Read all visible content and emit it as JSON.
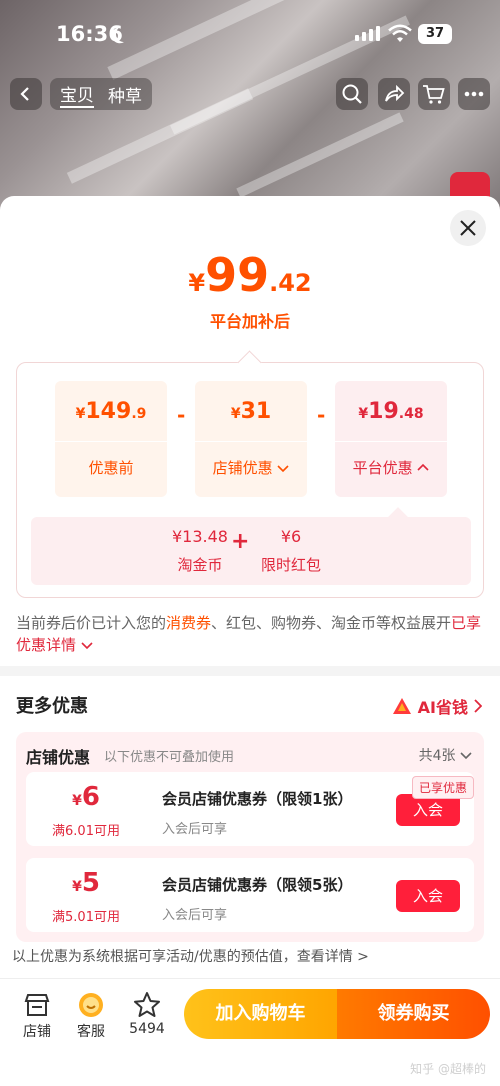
{
  "status": {
    "time": "16:36",
    "battery": "37"
  },
  "nav": {
    "tabs": [
      "宝贝",
      "种草"
    ]
  },
  "price": {
    "currency": "¥",
    "integer": "99",
    "decimal": ".42",
    "caption": "平台加补后"
  },
  "breakdown": {
    "original": {
      "currency": "¥",
      "integer": "149",
      "decimal": ".9",
      "label": "优惠前"
    },
    "store": {
      "currency": "¥",
      "integer": "31",
      "label": "店铺优惠"
    },
    "platform": {
      "currency": "¥",
      "integer": "19",
      "decimal": ".48",
      "label": "平台优惠"
    },
    "minus": "-",
    "sub": [
      {
        "value": "¥13.48",
        "label": "淘金币"
      },
      {
        "value": "¥6",
        "label": "限时红包"
      }
    ],
    "plus": "+"
  },
  "note": {
    "part1": "当前券后价已计入您的",
    "highlight": "消费券",
    "part2": "、红包、购物券、淘金币等权益展开",
    "link": "已享优惠详情"
  },
  "more": {
    "title": "更多优惠",
    "ai_label": "AI省钱"
  },
  "store_coupons": {
    "title": "店铺优惠",
    "hint": "以下优惠不可叠加使用",
    "count": "共4张",
    "items": [
      {
        "currency": "¥",
        "amount": "6",
        "condition": "满6.01可用",
        "name": "会员店铺优惠券（限领1张）",
        "desc": "入会后可享",
        "button": "入会",
        "tag": "已享优惠"
      },
      {
        "currency": "¥",
        "amount": "5",
        "condition": "满5.01可用",
        "name": "会员店铺优惠券（限领5张）",
        "desc": "入会后可享",
        "button": "入会"
      }
    ]
  },
  "disclaimer": "以上优惠为系统根据可享活动/优惠的预估值，查看详情 >",
  "bottom": {
    "store_label": "店铺",
    "service_label": "客服",
    "fav_count": "5494",
    "add_cart": "加入购物车",
    "buy": "领券购买"
  },
  "watermark": "知乎 @超棒的"
}
